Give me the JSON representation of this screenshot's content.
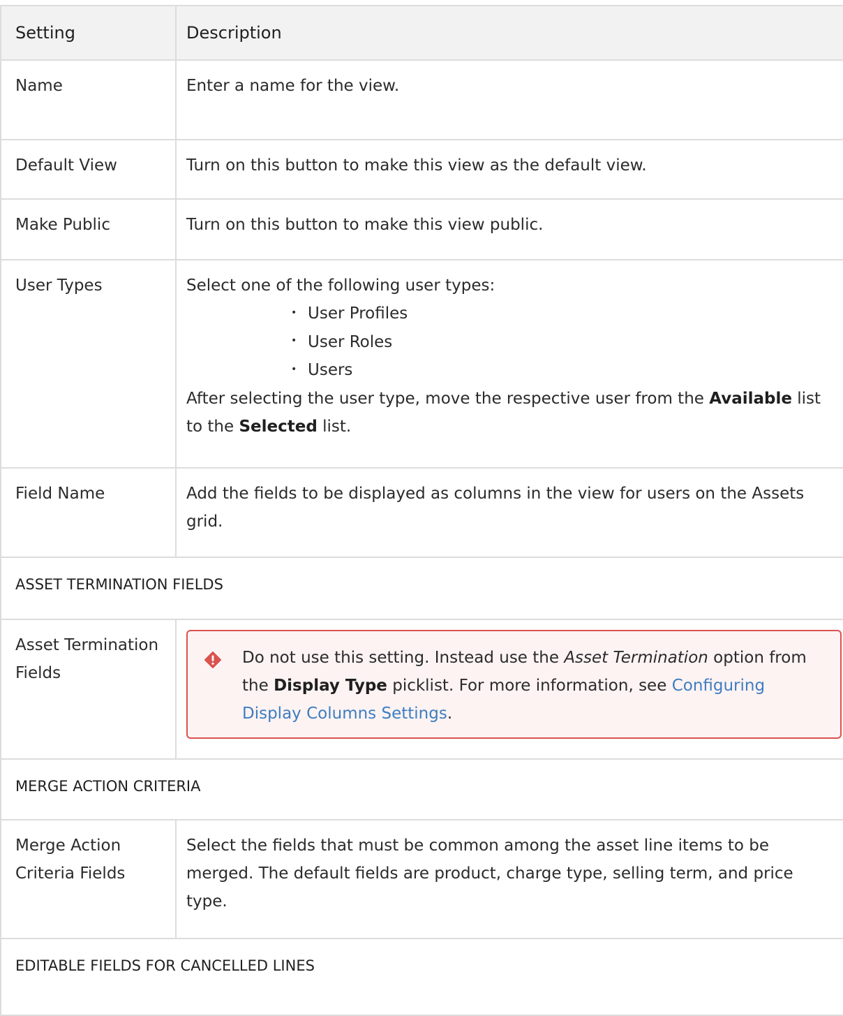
{
  "headers": {
    "setting": "Setting",
    "description": "Description"
  },
  "rows": {
    "name": {
      "setting": "Name",
      "description": "Enter a name for the view."
    },
    "default_view": {
      "setting": "Default View",
      "description": "Turn on this button to make this view as the default view."
    },
    "make_public": {
      "setting": "Make Public",
      "description": "Turn on this button to make this view public."
    },
    "user_types": {
      "setting": "User Types",
      "intro": "Select one of the following user types:",
      "options": [
        "User Profiles",
        "User Roles",
        "Users"
      ],
      "after_1": "After selecting the user type, move the respective user from the ",
      "available": "Available",
      "after_2": " list to the ",
      "selected": "Selected",
      "after_3": " list."
    },
    "field_name": {
      "setting": "Field Name",
      "description": "Add the fields to be displayed as columns in the view for users on the Assets grid."
    },
    "asset_termination_fields": {
      "setting": "Asset Termination Fields",
      "callout": {
        "icon": "warning-diamond-icon",
        "t1": "Do not use this setting. Instead use the ",
        "option": "Asset Termination",
        "t2": " option from the ",
        "display_type": "Display Type",
        "t3": " picklist. For more information, see ",
        "link": "Configuring Display Columns Settings",
        "t4": "."
      }
    },
    "merge_action_criteria_fields": {
      "setting": "Merge Action Criteria Fields",
      "description": "Select the fields that must be common among the asset line items to be merged. The default fields are product, charge type, selling term, and price type."
    }
  },
  "sections": {
    "asset_termination": "ASSET TERMINATION FIELDS",
    "merge_action": "MERGE ACTION CRITERIA",
    "editable_cancelled": "EDITABLE FIELDS FOR CANCELLED LINES"
  },
  "colors": {
    "callout_border": "#d9534f",
    "callout_bg": "#fdf3f3",
    "link": "#3e7dc0",
    "header_bg": "#f2f2f2",
    "grid": "#dcdcdc"
  }
}
